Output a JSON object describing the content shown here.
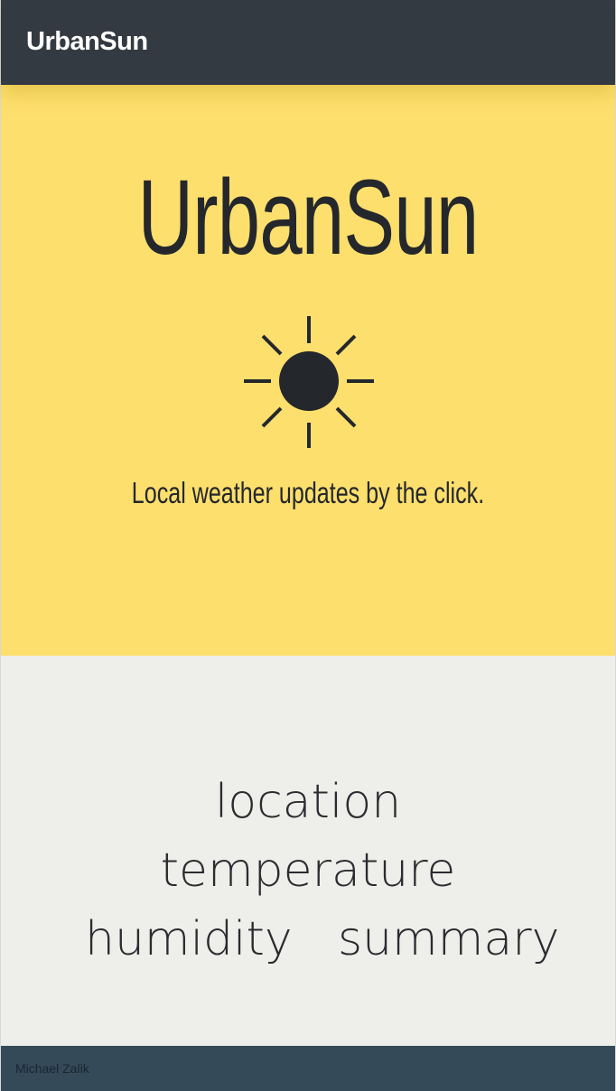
{
  "navbar": {
    "brand": "UrbanSun"
  },
  "hero": {
    "title": "UrbanSun",
    "icon": "sun-icon",
    "tagline": "Local weather updates by the click."
  },
  "weather": {
    "location": "location",
    "temperature": "temperature",
    "humidity": "humidity",
    "summary": "summary"
  },
  "footer": {
    "author": "Michael Zalik"
  },
  "colors": {
    "navbar": "#343a42",
    "hero_background": "#fddf6d",
    "content_background": "#eeeeea",
    "footer": "#344a59",
    "text_dark": "#24272c"
  }
}
